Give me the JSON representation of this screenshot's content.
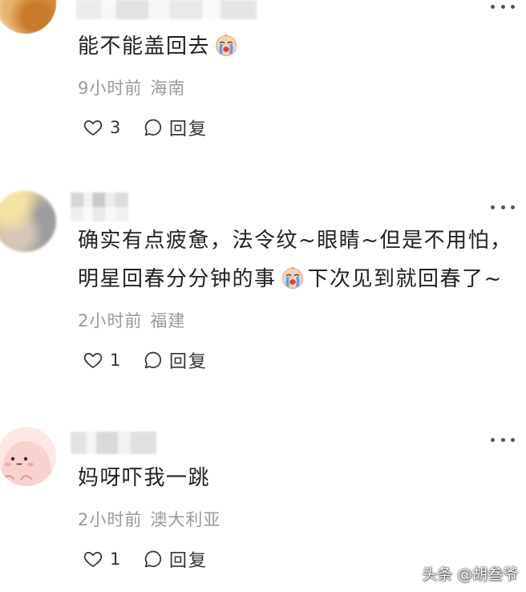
{
  "comments": [
    {
      "text": [
        "能不能盖回去"
      ],
      "emoji": "loudly-crying-face",
      "time": "9小时前",
      "location": "海南",
      "likes": "3",
      "reply_label": "回复"
    },
    {
      "text": [
        "确实有点疲惫，法令纹~眼睛~但是不用怕，",
        "明星回春分分钟的事",
        "下次见到就回春了~"
      ],
      "emoji": "loudly-crying-face",
      "time": "2小时前",
      "location": "福建",
      "likes": "1",
      "reply_label": "回复"
    },
    {
      "text": [
        "妈呀吓我一跳"
      ],
      "time": "2小时前",
      "location": "澳大利亚",
      "likes": "1",
      "reply_label": "回复"
    }
  ],
  "icons": {
    "like": "heart-outline-icon",
    "reply": "comment-bubble-icon",
    "more": "more-dots-icon"
  },
  "colors": {
    "background": "#ffffff",
    "text": "#222222",
    "meta": "#9a9a9a",
    "action": "#333333"
  },
  "watermark": {
    "platform": "头条",
    "handle": "@胡叁爷"
  }
}
